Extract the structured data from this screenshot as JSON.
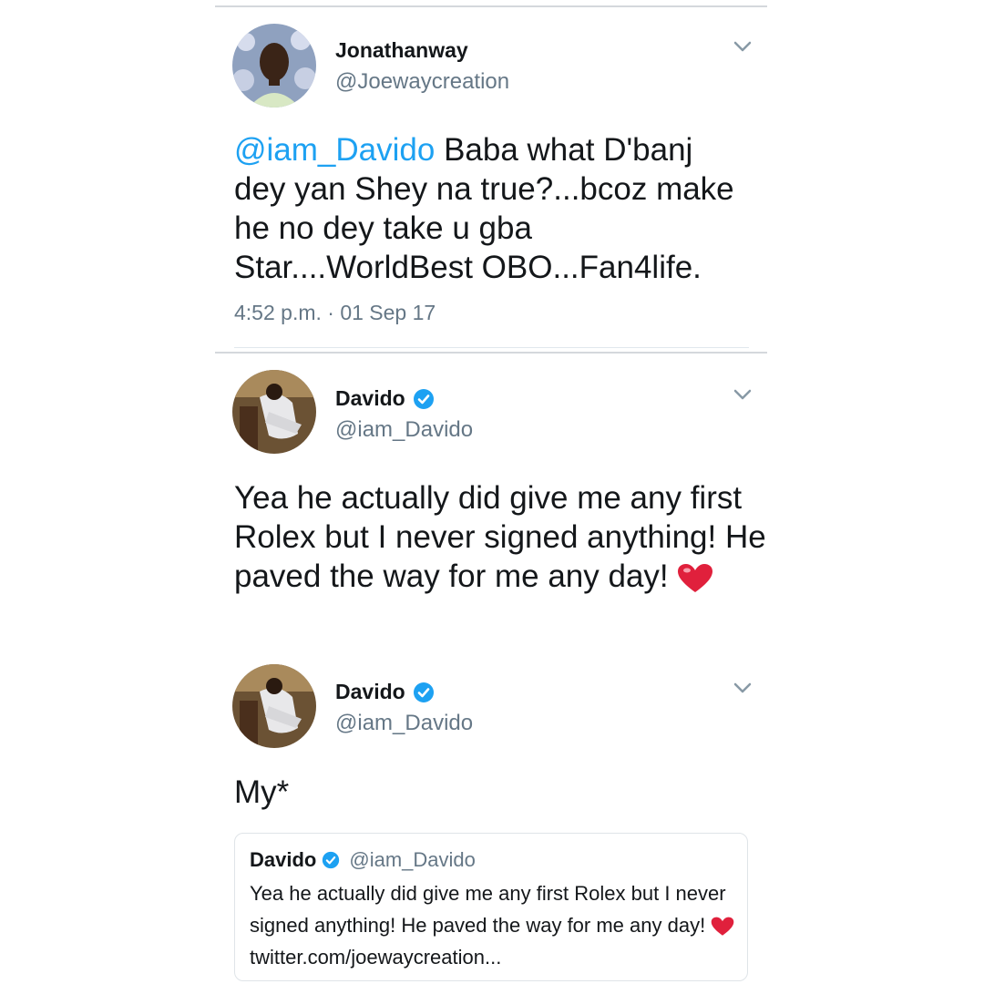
{
  "colors": {
    "link": "#1da1f2",
    "secondary": "#657786",
    "heart": "#e0203c",
    "verified": "#1da1f2"
  },
  "tweets": [
    {
      "name": "Jonathanway",
      "handle": "@Joewaycreation",
      "mention": "@iam_Davido",
      "text": " Baba what D'banj dey yan Shey na true?...bcoz make he no dey take u gba Star....WorldBest OBO...Fan4life.",
      "timestamp": "4:52 p.m. · 01 Sep 17"
    },
    {
      "name": "Davido",
      "handle": "@iam_Davido",
      "text": "Yea he actually did give me any first Rolex but I never signed anything! He paved the way for me any day!",
      "emoji": "heart-icon"
    },
    {
      "name": "Davido",
      "handle": "@iam_Davido",
      "text": "My*",
      "quote": {
        "name": "Davido",
        "handle": "@iam_Davido",
        "text": "Yea he actually did give me any first Rolex but I never signed anything! He paved the way for me any day!",
        "link": "twitter.com/joewaycreation..."
      }
    }
  ]
}
